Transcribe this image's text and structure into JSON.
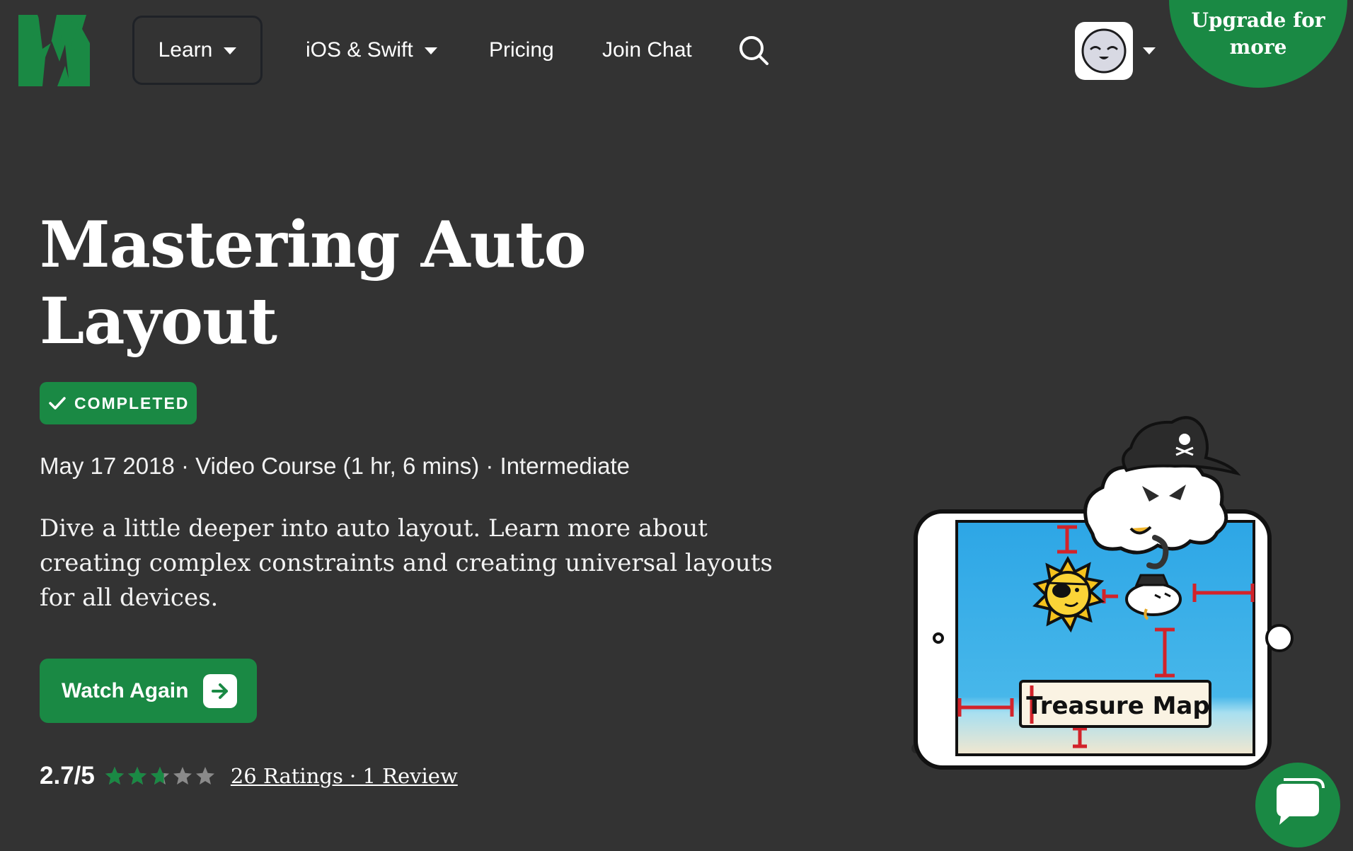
{
  "nav": {
    "logo": "raywenderlich-logo",
    "learn_label": "Learn",
    "ios_label": "iOS & Swift",
    "pricing_label": "Pricing",
    "chat_label": "Join Chat",
    "search_icon": "search-icon",
    "avatar_icon": "avatar-face-icon",
    "upgrade_label": "Upgrade for more"
  },
  "course": {
    "title": "Mastering Auto Layout",
    "badge_label": "COMPLETED",
    "meta": "May 17 2018 · Video Course (1 hr, 6 mins) · Intermediate",
    "description": "Dive a little deeper into auto layout. Learn more about creating complex constraints and creating universal layouts for all devices.",
    "cta_label": "Watch Again",
    "rating_score": "2.7/5",
    "rating_value": 2.7,
    "rating_max": 5,
    "ratings_link": "26 Ratings · 1 Review"
  },
  "illustration": {
    "sign_text": "Treasure Map"
  },
  "colors": {
    "background": "#333333",
    "brand_green": "#1a8944",
    "star_empty": "#8a8a8a"
  }
}
